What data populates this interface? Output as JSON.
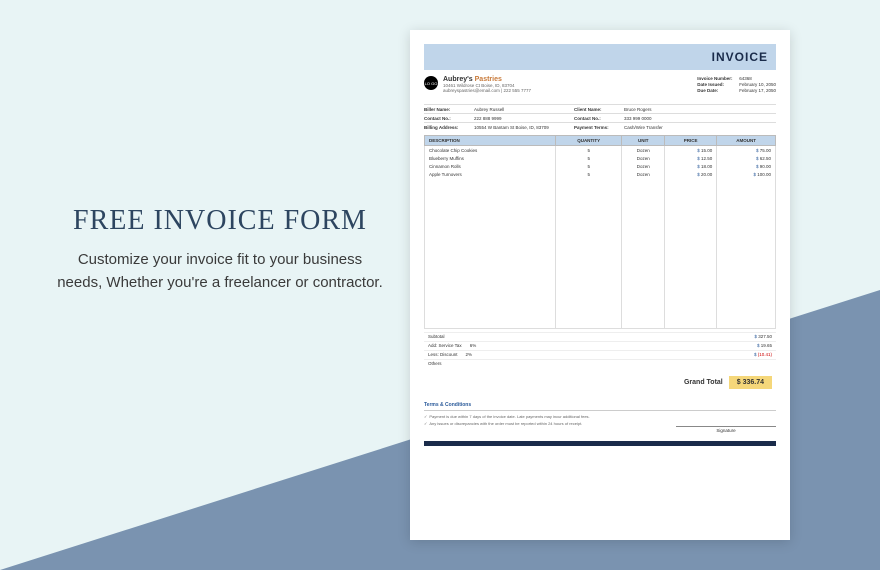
{
  "promo": {
    "title": "FREE INVOICE FORM",
    "subtitle": "Customize your invoice fit to your business needs, Whether you're a freelancer or contractor."
  },
  "invoice": {
    "header": "INVOICE",
    "logo": "LO GO",
    "company_name_1": "Aubrey's",
    "company_name_2": "Pastries",
    "company_addr": "10461 Wildrose Ct Boise, ID, 83704",
    "company_contact": "aubreyspastries@email.com | 222 555 7777",
    "meta": {
      "number_label": "Invoice Number:",
      "number": "64368",
      "date_label": "Date Issued:",
      "date": "February 10, 2050",
      "due_label": "Due Date:",
      "due": "February 17, 2050"
    },
    "party": {
      "biller_label": "Biller Name:",
      "biller": "Aubrey Russell",
      "client_label": "Client Name:",
      "client": "Bruce Rogers",
      "contact_label": "Contact No.:",
      "contact": "222 888 9999",
      "contact2_label": "Contact No.:",
      "contact2": "333 999 0000",
      "addr_label": "Billing Address:",
      "addr": "10554 W Bantam St Boise, ID, 83709",
      "terms_label": "Payment Terms:",
      "terms": "Cash/Wire Transfer"
    },
    "columns": {
      "desc": "DESCRIPTION",
      "qty": "QUANTITY",
      "unit": "UNIT",
      "price": "PRICE",
      "amount": "AMOUNT"
    },
    "items": [
      {
        "desc": "Chocolate Chip Cookies",
        "qty": "5",
        "unit": "Dozen",
        "price": "15.00",
        "amount": "75.00"
      },
      {
        "desc": "Blueberry Muffins",
        "qty": "5",
        "unit": "Dozen",
        "price": "12.50",
        "amount": "62.50"
      },
      {
        "desc": "Cinnamon Rolls",
        "qty": "5",
        "unit": "Dozen",
        "price": "18.00",
        "amount": "90.00"
      },
      {
        "desc": "Apple Turnovers",
        "qty": "5",
        "unit": "Dozen",
        "price": "20.00",
        "amount": "100.00"
      }
    ],
    "totals": {
      "subtotal_label": "Subtotal",
      "subtotal": "327.50",
      "tax_label": "Add: Service Tax",
      "tax_pct": "6%",
      "tax": "19.65",
      "discount_label": "Less: Discount",
      "discount_pct": "2%",
      "discount": "(10.41)",
      "others_label": "Others",
      "grand_label": "Grand Total",
      "grand": "$     336.74"
    },
    "terms_section": {
      "heading": "Terms & Conditions",
      "t1": "Payment is due within 7 days of the invoice date. Late payments may incur additional fees.",
      "t2": "Any issues or discrepancies with the order must be reported within 24 hours of receipt.",
      "signature": "Signature"
    }
  }
}
